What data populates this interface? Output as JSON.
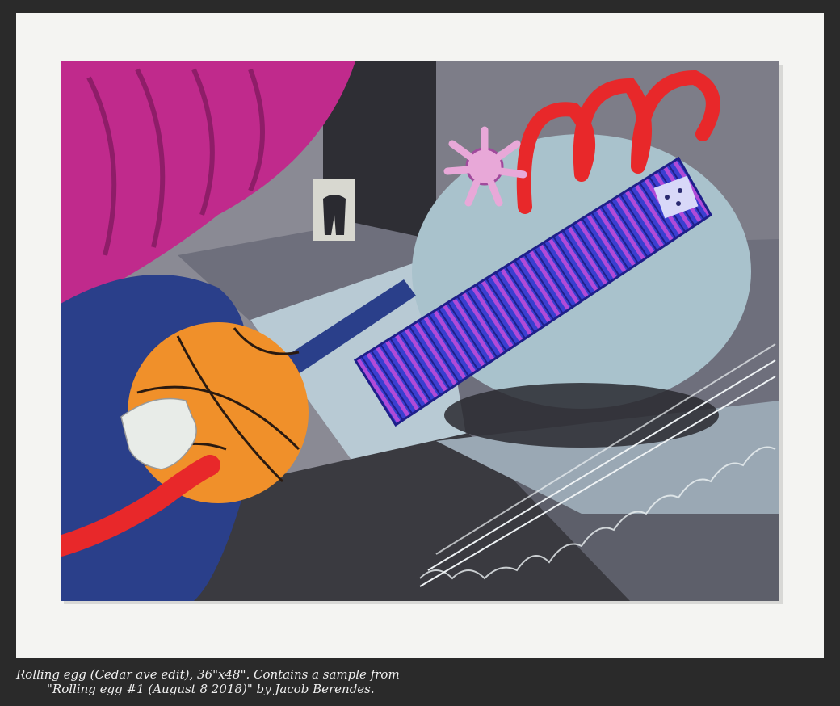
{
  "caption": {
    "line1": "Rolling egg (Cedar ave edit), 36\"x48\". Contains a sample from",
    "line2": "\"Rolling egg #1 (August 8 2018)\" by Jacob Berendes."
  },
  "colors": {
    "background": "#2a2a2a",
    "wall": "#f4f4f2",
    "curtain": "#c02a8c",
    "dark_gray": "#3a3a40",
    "egg": "#a9c2cc",
    "dominoes_blue": "#3a3fd0",
    "dominoes_purple": "#a04ad0",
    "basketball": "#f0902a",
    "sleeve": "#2a3f8a",
    "spiral": "#e8282a",
    "hand": "#e8ece8"
  }
}
